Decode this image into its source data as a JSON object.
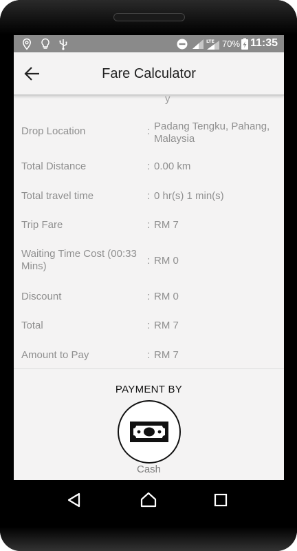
{
  "status_bar": {
    "battery_percent": "70%",
    "time": "11:35",
    "left_icons": [
      "location-pin-icon",
      "lightbulb-icon",
      "usb-icon"
    ],
    "right_icons": [
      "do-not-disturb-icon",
      "signal-icon",
      "lte-signal-icon",
      "battery-charging-icon"
    ]
  },
  "app_bar": {
    "title": "Fare Calculator",
    "back_icon": "arrow-left-icon"
  },
  "fare_details": {
    "cut_off_text": "y",
    "separator": ":",
    "rows": [
      {
        "label": "Drop Location",
        "value": "Padang Tengku, Pahang, Malaysia"
      },
      {
        "label": "Total Distance",
        "value": "0.00  km"
      },
      {
        "label": "Total travel time",
        "value": "0 hr(s) 1 min(s)"
      },
      {
        "label": "Trip Fare",
        "value": "RM  7"
      },
      {
        "label": "Waiting Time Cost (00:33 Mins)",
        "value": "RM  0"
      },
      {
        "label": "Discount",
        "value": "RM  0"
      },
      {
        "label": "Total",
        "value": "RM  7"
      },
      {
        "label": "Amount to Pay",
        "value": "RM  7"
      }
    ]
  },
  "payment": {
    "title": "PAYMENT BY",
    "method_label": "Cash",
    "method_icon": "cash-banknote-icon"
  },
  "nav_bar": {
    "icons": [
      "back-triangle-icon",
      "home-circle-icon",
      "recents-square-icon"
    ]
  },
  "colors": {
    "status_bar": "#8a8a8a",
    "screen_background": "#f4f3f3",
    "label_text": "#8f8f8f",
    "frame": "#000000"
  }
}
